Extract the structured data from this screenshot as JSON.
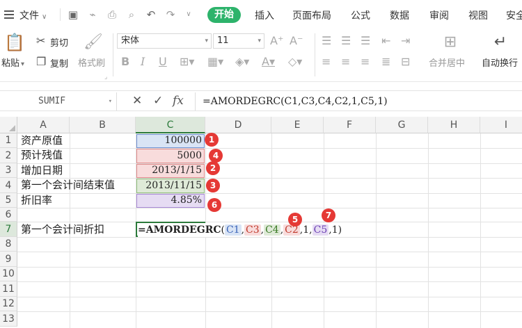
{
  "menubar": {
    "file_label": "文件",
    "tabs": [
      "开始",
      "插入",
      "页面布局",
      "公式",
      "数据",
      "审阅",
      "视图",
      "安全"
    ]
  },
  "ribbon": {
    "paste": "粘贴",
    "cut": "剪切",
    "copy": "复制",
    "format_painter": "格式刷",
    "font_name": "宋体",
    "font_size": "11",
    "merge_center": "合并居中",
    "wrap_text": "自动换行"
  },
  "formula_bar": {
    "name_box": "SUMIF",
    "cancel_icon": "✕",
    "confirm_icon": "✓",
    "fx": "fx",
    "formula": "=AMORDEGRC(C1,C3,C4,C2,1,C5,1)"
  },
  "sheet": {
    "columns": [
      "A",
      "B",
      "C",
      "D",
      "E",
      "F",
      "G",
      "H",
      "I"
    ],
    "active_column": "C",
    "rows": [
      "1",
      "2",
      "3",
      "4",
      "5",
      "6",
      "7",
      "8",
      "9",
      "10",
      "11",
      "12",
      "13"
    ],
    "active_row": "7",
    "labels": {
      "a1": "资产原值",
      "a2": "预计残值",
      "a3": "增加日期",
      "a4": "第一个会计间结束值",
      "a5": "折旧率",
      "a7": "第一个会计间折扣"
    },
    "values": {
      "c1": "100000",
      "c2": "5000",
      "c3": "2013/1/15",
      "c4": "2013/11/15",
      "c5": "4.85%"
    },
    "edit_formula": {
      "prefix": "=AMORDEGRC",
      "open": "(",
      "r1": "C1",
      "r2": "C3",
      "r3": "C4",
      "r4": "C2",
      "one_a": "1",
      "r5": "C5",
      "one_b": "1)",
      "comma": ","
    },
    "badges": [
      "1",
      "4",
      "2",
      "3",
      "6",
      "5",
      "7"
    ]
  },
  "colors": {
    "accent": "#2db36b",
    "badge": "#e53935",
    "ref_c1": "#d9e4f5",
    "ref_c2": "#f8dcdc",
    "ref_c3": "#f8dcdc",
    "ref_c4": "#dfead8",
    "ref_c5": "#e6dcf3"
  }
}
